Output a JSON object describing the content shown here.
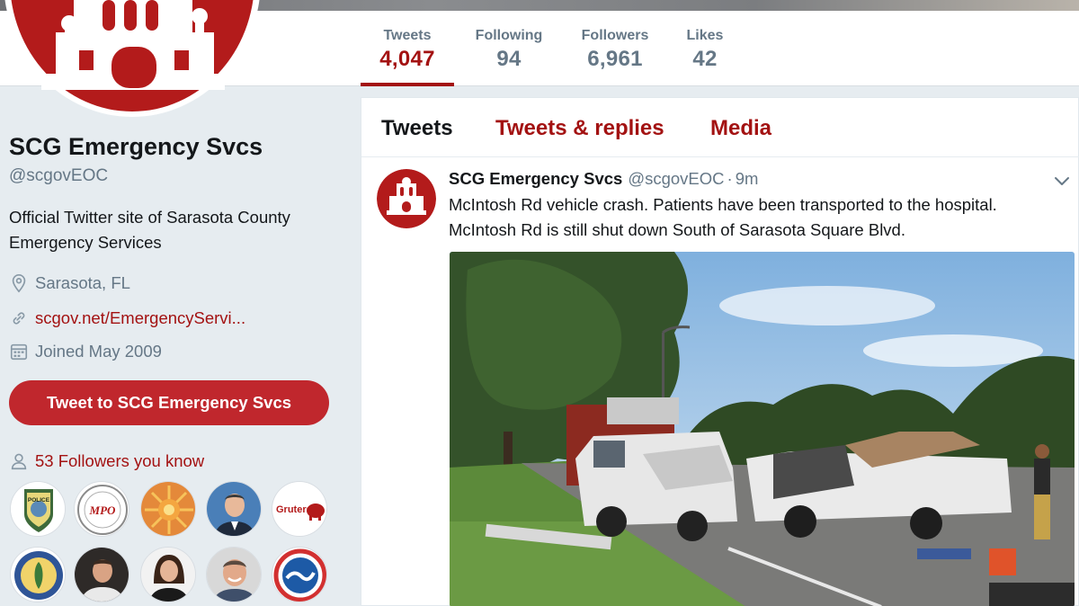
{
  "stats": [
    {
      "label": "Tweets",
      "value": "4,047"
    },
    {
      "label": "Following",
      "value": "94"
    },
    {
      "label": "Followers",
      "value": "6,961"
    },
    {
      "label": "Likes",
      "value": "42"
    }
  ],
  "profile": {
    "name": "SCG Emergency Svcs",
    "handle": "@scgovEOC",
    "bio": "Official Twitter site of Sarasota County Emergency Services",
    "location": "Sarasota, FL",
    "url": "scgov.net/EmergencyServi...",
    "joined": "Joined May 2009",
    "tweet_to_label": "Tweet to SCG Emergency Svcs",
    "followers_you_know": "53 Followers you know",
    "known_followers": [
      {
        "name": "police-badge-avatar",
        "badge_text": "POLICE"
      },
      {
        "name": "mpo-seal-avatar",
        "badge_text": "MPO"
      },
      {
        "name": "sun-avatar"
      },
      {
        "name": "man-in-suit-avatar"
      },
      {
        "name": "gruters-logo-avatar",
        "badge_text": "Gruters"
      },
      {
        "name": "school-seal-avatar"
      },
      {
        "name": "man-avatar"
      },
      {
        "name": "woman-avatar"
      },
      {
        "name": "smiling-man-avatar"
      },
      {
        "name": "weather-service-avatar"
      }
    ]
  },
  "tabs": {
    "tweets": "Tweets",
    "replies": "Tweets & replies",
    "media": "Media"
  },
  "tweet": {
    "author": "SCG Emergency Svcs",
    "handle": "@scgovEOC",
    "separator": "·",
    "time": "9m",
    "text_line1": "McIntosh Rd vehicle crash. Patients have been transported to the hospital.",
    "text_line2": "McIntosh Rd is still shut down South of Sarasota Square Blvd.",
    "photo": "crash-scene-photo"
  },
  "colors": {
    "brand": "#a31212",
    "button": "#c0272d",
    "muted": "#657786",
    "background": "#e6ecf0"
  }
}
